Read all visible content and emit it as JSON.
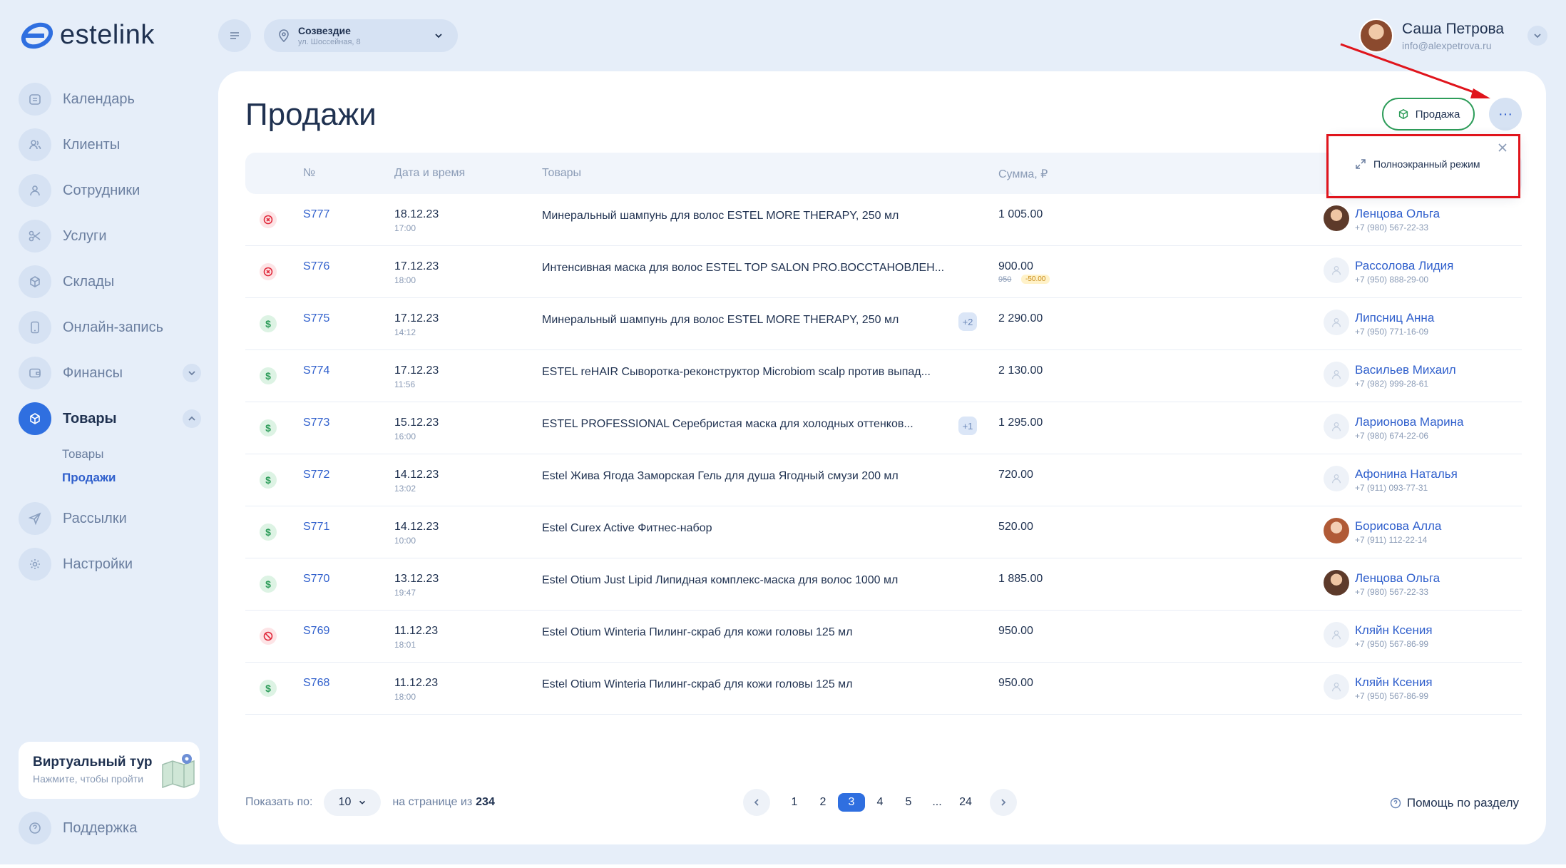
{
  "brand": {
    "name": "estelink",
    "accent": "#2f6fe0",
    "success": "#2e9d5a",
    "danger": "#e0283a"
  },
  "location": {
    "name": "Созвездие",
    "address": "ул. Шоссейная, 8"
  },
  "user": {
    "name": "Саша Петрова",
    "email": "info@alexpetrova.ru"
  },
  "sidebar": {
    "items": [
      {
        "label": "Календарь",
        "icon": "calendar-icon"
      },
      {
        "label": "Клиенты",
        "icon": "clients-icon"
      },
      {
        "label": "Сотрудники",
        "icon": "staff-icon"
      },
      {
        "label": "Услуги",
        "icon": "scissors-icon"
      },
      {
        "label": "Склады",
        "icon": "warehouse-icon"
      },
      {
        "label": "Онлайн-запись",
        "icon": "phone-icon"
      },
      {
        "label": "Финансы",
        "icon": "wallet-icon"
      },
      {
        "label": "Товары",
        "icon": "goods-icon"
      },
      {
        "label": "Рассылки",
        "icon": "send-icon"
      },
      {
        "label": "Настройки",
        "icon": "gear-icon"
      }
    ],
    "subitems": [
      {
        "label": "Товары"
      },
      {
        "label": "Продажи"
      }
    ],
    "tour": {
      "title": "Виртуальный тур",
      "subtitle": "Нажмите, чтобы пройти"
    },
    "support": "Поддержка"
  },
  "page": {
    "title": "Продажи",
    "sale_button": "Продажа",
    "more_button": "···",
    "fullscreen_label": "Полноэкранный режим"
  },
  "table": {
    "headers": {
      "num": "№",
      "datetime": "Дата и время",
      "goods": "Товары",
      "sum": "Сумма, ₽"
    },
    "rows": [
      {
        "status": "cancel",
        "num": "S777",
        "date": "18.12.23",
        "time": "17:00",
        "goods": "Минеральный шампунь для волос ESTEL MORE THERAPY, 250 мл",
        "extra": "",
        "sum": "1 005.00",
        "old": "",
        "disc": "",
        "client": "Ленцова Ольга",
        "phone": "+7 (980) 567-22-33",
        "avatar": "photo1"
      },
      {
        "status": "cancel",
        "num": "S776",
        "date": "17.12.23",
        "time": "18:00",
        "goods": "Интенсивная маска для волос ESTEL TOP SALON PRO.ВОССТАНОВЛЕН...",
        "extra": "",
        "sum": "900.00",
        "old": "950",
        "disc": "-50.00",
        "client": "Рассолова Лидия",
        "phone": "+7 (950) 888-29-00",
        "avatar": "none"
      },
      {
        "status": "paid",
        "num": "S775",
        "date": "17.12.23",
        "time": "14:12",
        "goods": "Минеральный шампунь для волос ESTEL MORE THERAPY, 250 мл",
        "extra": "+2",
        "sum": "2 290.00",
        "old": "",
        "disc": "",
        "client": "Липсниц Анна",
        "phone": "+7 (950) 771-16-09",
        "avatar": "none"
      },
      {
        "status": "paid",
        "num": "S774",
        "date": "17.12.23",
        "time": "11:56",
        "goods": "ESTEL reHAIR Сыворотка-реконструктор Microbiom scalp против выпад...",
        "extra": "",
        "sum": "2 130.00",
        "old": "",
        "disc": "",
        "client": "Васильев Михаил",
        "phone": "+7 (982) 999-28-61",
        "avatar": "none"
      },
      {
        "status": "paid",
        "num": "S773",
        "date": "15.12.23",
        "time": "16:00",
        "goods": "ESTEL PROFESSIONAL Серебристая маска для холодных оттенков...",
        "extra": "+1",
        "sum": "1 295.00",
        "old": "",
        "disc": "",
        "client": "Ларионова Марина",
        "phone": "+7 (980) 674-22-06",
        "avatar": "none"
      },
      {
        "status": "paid",
        "num": "S772",
        "date": "14.12.23",
        "time": "13:02",
        "goods": "Estel Жива Ягода Заморская Гель для душа Ягодный смузи 200 мл",
        "extra": "",
        "sum": "720.00",
        "old": "",
        "disc": "",
        "client": "Афонина Наталья",
        "phone": "+7 (911) 093-77-31",
        "avatar": "none"
      },
      {
        "status": "paid",
        "num": "S771",
        "date": "14.12.23",
        "time": "10:00",
        "goods": "Estel Curex Active Фитнес-набор",
        "extra": "",
        "sum": "520.00",
        "old": "",
        "disc": "",
        "client": "Борисова Алла",
        "phone": "+7 (911) 112-22-14",
        "avatar": "photo2"
      },
      {
        "status": "paid",
        "num": "S770",
        "date": "13.12.23",
        "time": "19:47",
        "goods": "Estel Otium Just Lipid Липидная комплекс-маска для волос 1000 мл",
        "extra": "",
        "sum": "1 885.00",
        "old": "",
        "disc": "",
        "client": "Ленцова Ольга",
        "phone": "+7 (980) 567-22-33",
        "avatar": "photo1"
      },
      {
        "status": "cancel",
        "num": "S769",
        "date": "11.12.23",
        "time": "18:01",
        "goods": "Estel Otium Winteria Пилинг-скраб для кожи головы 125 мл",
        "extra": "",
        "sum": "950.00",
        "old": "",
        "disc": "",
        "client": "Кляйн Ксения",
        "phone": "+7 (950) 567-86-99",
        "avatar": "none"
      },
      {
        "status": "paid",
        "num": "S768",
        "date": "11.12.23",
        "time": "18:00",
        "goods": "Estel Otium Winteria Пилинг-скраб для кожи головы 125 мл",
        "extra": "",
        "sum": "950.00",
        "old": "",
        "disc": "",
        "client": "Кляйн Ксения",
        "phone": "+7 (950) 567-86-99",
        "avatar": "none"
      }
    ]
  },
  "footer": {
    "show_label": "Показать по:",
    "per_page": "10",
    "of_label": "на странице из",
    "total": "234",
    "pages": [
      "1",
      "2",
      "3",
      "4",
      "5",
      "...",
      "24"
    ],
    "current_page": "3",
    "help": "Помощь по разделу"
  }
}
